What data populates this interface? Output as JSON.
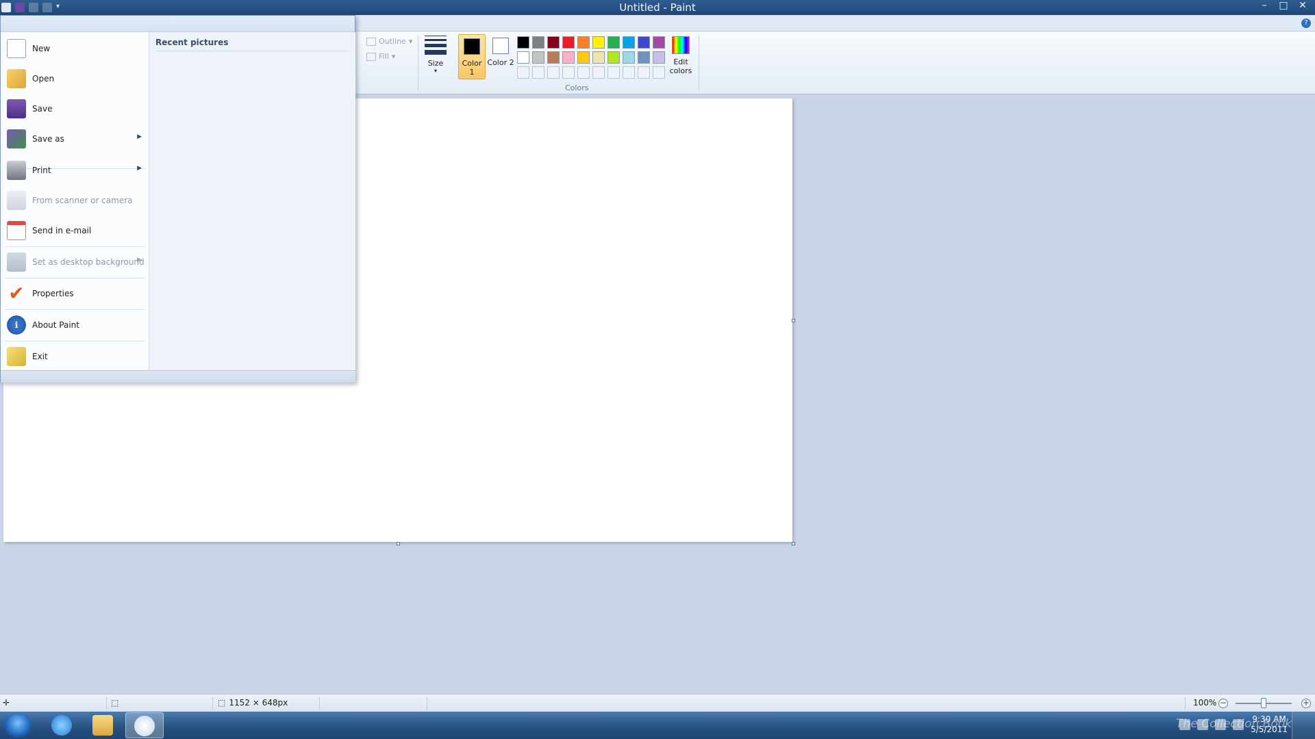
{
  "window": {
    "title": "Untitled - Paint"
  },
  "window_controls": {
    "minimize": "–",
    "maximize": "□",
    "close": "✕"
  },
  "ribbon": {
    "outline_label": "Outline",
    "fill_label": "Fill",
    "size_label": "Size",
    "color1_label": "Color 1",
    "color2_label": "Color 2",
    "color1_value": "#000000",
    "color2_value": "#ffffff",
    "edit_colors_label": "Edit colors",
    "colors_group_label": "Colors",
    "palette": [
      "#000000",
      "#7f7f7f",
      "#880015",
      "#ed1c24",
      "#ff7f27",
      "#fff200",
      "#22b14c",
      "#00a2e8",
      "#3f48cc",
      "#a349a4",
      "#ffffff",
      "#c3c3c3",
      "#b97a57",
      "#ffaec9",
      "#ffc90e",
      "#efe4b0",
      "#b5e61d",
      "#99d9ea",
      "#7092be",
      "#c8bfe7"
    ],
    "custom_slots": 10
  },
  "app_menu": {
    "recent_title": "Recent pictures",
    "items": [
      {
        "label": "New",
        "icon": "new-file-icon",
        "submenu": false,
        "enabled": true
      },
      {
        "label": "Open",
        "icon": "open-folder-icon",
        "submenu": false,
        "enabled": true
      },
      {
        "label": "Save",
        "icon": "save-disk-icon",
        "submenu": false,
        "enabled": true
      },
      {
        "label": "Save as",
        "icon": "save-as-icon",
        "submenu": true,
        "enabled": true
      },
      {
        "label": "Print",
        "icon": "printer-icon",
        "submenu": true,
        "enabled": true
      },
      {
        "label": "From scanner or camera",
        "icon": "scanner-icon",
        "submenu": false,
        "enabled": false
      },
      {
        "label": "Send in e-mail",
        "icon": "email-icon",
        "submenu": false,
        "enabled": true
      },
      {
        "label": "Set as desktop background",
        "icon": "desktop-background-icon",
        "submenu": true,
        "enabled": false
      },
      {
        "label": "Properties",
        "icon": "checkmark-icon",
        "submenu": false,
        "enabled": true
      },
      {
        "label": "About Paint",
        "icon": "info-icon",
        "submenu": false,
        "enabled": true
      },
      {
        "label": "Exit",
        "icon": "exit-icon",
        "submenu": false,
        "enabled": true
      }
    ]
  },
  "statusbar": {
    "canvas_size": "1152 × 648px",
    "zoom": "100%"
  },
  "taskbar": {
    "clock_time": "9:30 AM",
    "clock_date": "5/5/2011",
    "watermark": "The Collection Book"
  }
}
